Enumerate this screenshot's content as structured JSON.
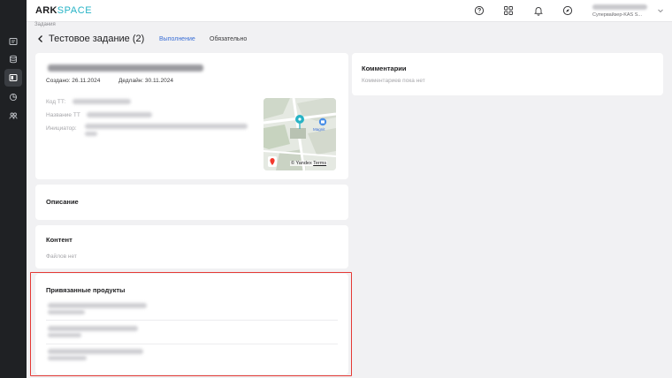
{
  "app": {
    "logo_main": "ARK",
    "logo_accent": "SPACE"
  },
  "header": {
    "user_role": "Супервайзер-KAS S...",
    "icons": [
      "help-icon",
      "apps-grid-icon",
      "bell-icon",
      "compass-icon"
    ]
  },
  "breadcrumb": "Задания",
  "page": {
    "title": "Тестовое задание (2)",
    "tabs": [
      {
        "label": "Выполнение",
        "active": true
      },
      {
        "label": "Обязательно",
        "active": false
      }
    ]
  },
  "task_card": {
    "created": "Создано: 26.11.2024",
    "deadline": "Дедлайн: 30.11.2024",
    "fields": [
      {
        "label": "Код ТТ:"
      },
      {
        "label": "Название ТТ"
      },
      {
        "label": "Инициатор:"
      }
    ],
    "map": {
      "credit": "© Yandex",
      "terms": "Terms",
      "poi": "Magnit"
    }
  },
  "description_card": {
    "title": "Описание"
  },
  "content_card": {
    "title": "Контент",
    "empty": "Файлов нет"
  },
  "products_card": {
    "title": "Привязанные продукты"
  },
  "comments_card": {
    "title": "Комментарии",
    "empty": "Комментариев пока нет"
  },
  "colors": {
    "accent": "#3b6fd6",
    "brand": "#26b3c6",
    "highlight": "#e53935",
    "sidebar": "#1f2124"
  }
}
